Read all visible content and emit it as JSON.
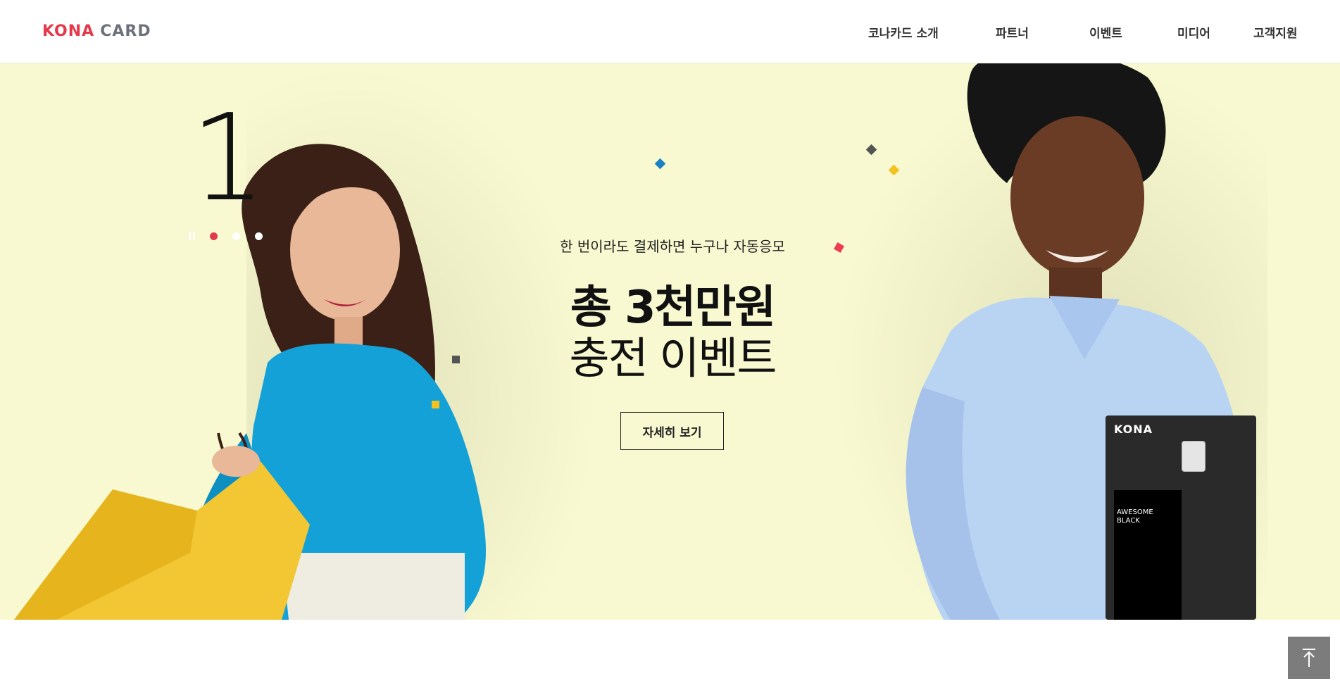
{
  "header": {
    "logo_mark": "KONA",
    "logo_word": "CARD",
    "nav": [
      {
        "label": "코나카드 소개"
      },
      {
        "label": "파트너"
      },
      {
        "label": "이벤트"
      },
      {
        "label": "미디어"
      },
      {
        "label": "고객지원"
      }
    ]
  },
  "hero": {
    "slide_number": "1",
    "subtitle": "한 번이라도 결제하면 누구나 자동응모",
    "title_line1": "총 3천만원",
    "title_line2": "충전 이벤트",
    "cta_label": "자세히 보기",
    "card_brand": "KONA",
    "card_text": "AWESOME\nBLACK"
  },
  "colors": {
    "brand_red": "#e3394b",
    "hero_bg": "#f8f9d0",
    "top_button_bg": "#7c7c7c"
  },
  "icons": {
    "top_button": "arrow-up-to-top-icon",
    "slider_pause": "pause-icon"
  }
}
